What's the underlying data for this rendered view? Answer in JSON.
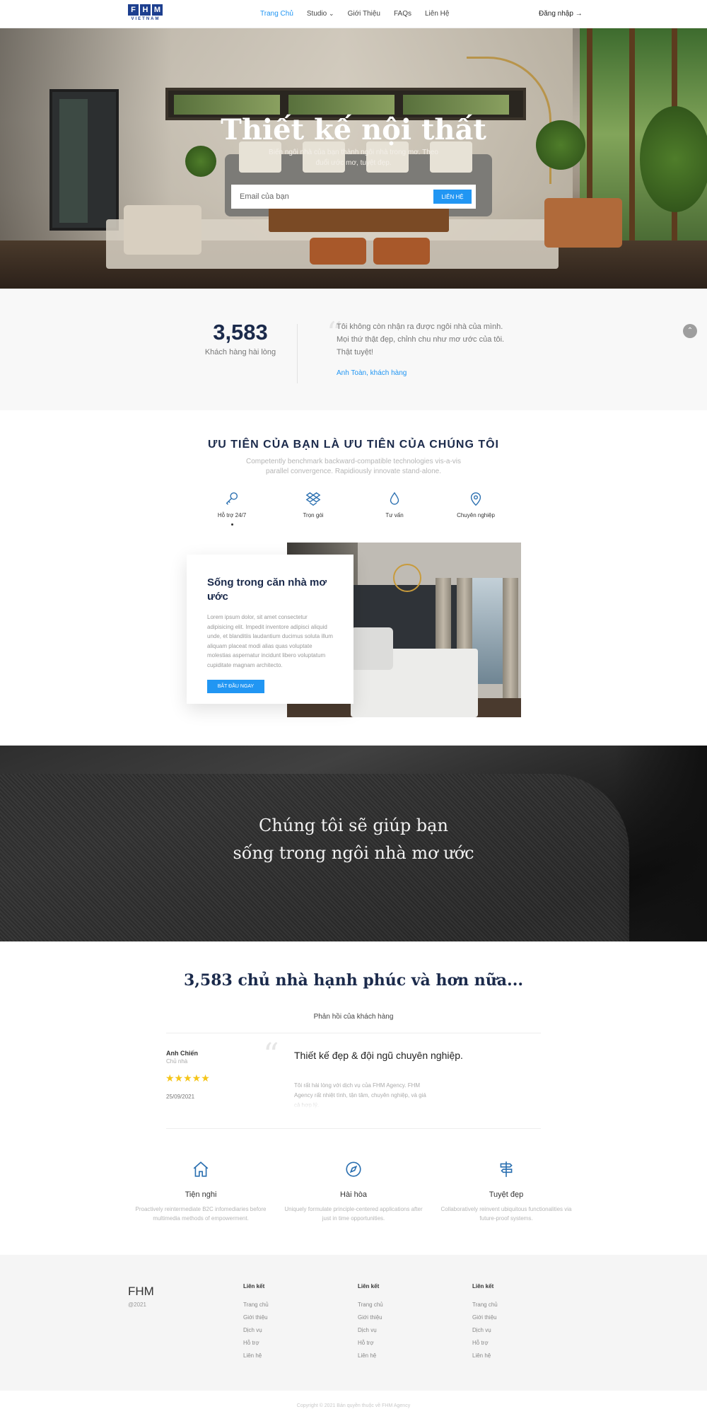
{
  "nav": {
    "logo_letters": [
      "F",
      "H",
      "M"
    ],
    "logo_sub": "VIETNAM",
    "items": [
      "Trang Chủ",
      "Studio",
      "Giới Thiệu",
      "FAQs",
      "Liên Hệ"
    ],
    "studio_caret": "⌄",
    "login": "Đăng nhập →",
    "active_color": "#2196f3"
  },
  "hero": {
    "title": "Thiết kế nội thất",
    "subtitle": "Biến ngôi nhà của bạn thành ngôi nhà trong mơ. Theo đuổi ước mơ, tuyệt đẹp.",
    "email_placeholder": "Email của bạn",
    "button": "LIÊN HỆ"
  },
  "stats": {
    "number": "3,583",
    "label": "Khách hàng hài lòng",
    "quote": "Tôi không còn nhận ra được ngôi nhà của mình. Mọi thứ thật đẹp, chỉnh chu như mơ ước của tôi. Thật tuyệt!",
    "author": "Anh Toàn, khách hàng"
  },
  "priority": {
    "title": "ƯU TIÊN CỦA BẠN LÀ ƯU TIÊN CỦA CHÚNG TÔI",
    "subtitle": "Competently benchmark backward-compatible technologies vis-a-vis parallel convergence. Rapidiously innovate stand-alone.",
    "features": [
      {
        "icon": "key-icon",
        "label": "Hỗ trợ 24/7"
      },
      {
        "icon": "dropbox-icon",
        "label": "Trọn gói"
      },
      {
        "icon": "drop-icon",
        "label": "Tư vấn"
      },
      {
        "icon": "map-pin-icon",
        "label": "Chuyên nghiệp"
      }
    ]
  },
  "card": {
    "title": "Sống trong căn nhà mơ ước",
    "text": "Lorem ipsum dolor, sit amet consectetur adipisicing elit. Impedit inventore adipisci aliquid unde, et blanditiis laudantium ducimus soluta illum aliquam placeat modi alias quas voluptate molestias aspernatur incidunt libero voluptatum cupiditate magnam architecto.",
    "button": "BẮT ĐẦU NGAY"
  },
  "banner": {
    "line1": "Chúng tôi sẽ giúp bạn",
    "line2": "sống trong ngôi nhà mơ ước"
  },
  "reviews": {
    "title": "3,583 chủ nhà hạnh phúc và hơn nữa...",
    "subtitle": "Phản hồi của khách hàng",
    "name": "Anh Chiến",
    "role": "Chủ nhà",
    "stars": "★★★★★",
    "rating": 5,
    "date": "25/09/2021",
    "headline": "Thiết kế đẹp & đội ngũ chuyên nghiệp.",
    "text": "Tôi rất hài lòng với dịch vụ của FHM Agency. FHM Agency rất nhiệt tình, tận tâm, chuyên nghiệp, và giá cả hợp lý."
  },
  "values": [
    {
      "icon": "home-icon",
      "title": "Tiện nghi",
      "text": "Proactively reintermediate B2C infomediaries before multimedia methods of empowerment."
    },
    {
      "icon": "compass-icon",
      "title": "Hài hòa",
      "text": "Uniquely formulate principle-centered applications after just in time opportunities."
    },
    {
      "icon": "signpost-icon",
      "title": "Tuyệt đẹp",
      "text": "Collaboratively reinvent ubiquitous functionalities via future-proof systems."
    }
  ],
  "footer": {
    "brand": "FHM",
    "year": "@2021",
    "columns": [
      {
        "title": "Liên kết",
        "items": [
          "Trang chủ",
          "Giới thiệu",
          "Dịch vụ",
          "Hỗ trợ",
          "Liên hệ"
        ]
      },
      {
        "title": "Liên kết",
        "items": [
          "Trang chủ",
          "Giới thiệu",
          "Dịch vụ",
          "Hỗ trợ",
          "Liên hệ"
        ]
      },
      {
        "title": "Liên kết",
        "items": [
          "Trang chủ",
          "Giới thiệu",
          "Dịch vụ",
          "Hỗ trợ",
          "Liên hệ"
        ]
      }
    ],
    "copyright": "Copyright © 2021 Bản quyền thuộc về FHM Agency"
  },
  "scroll_top": "⌃"
}
